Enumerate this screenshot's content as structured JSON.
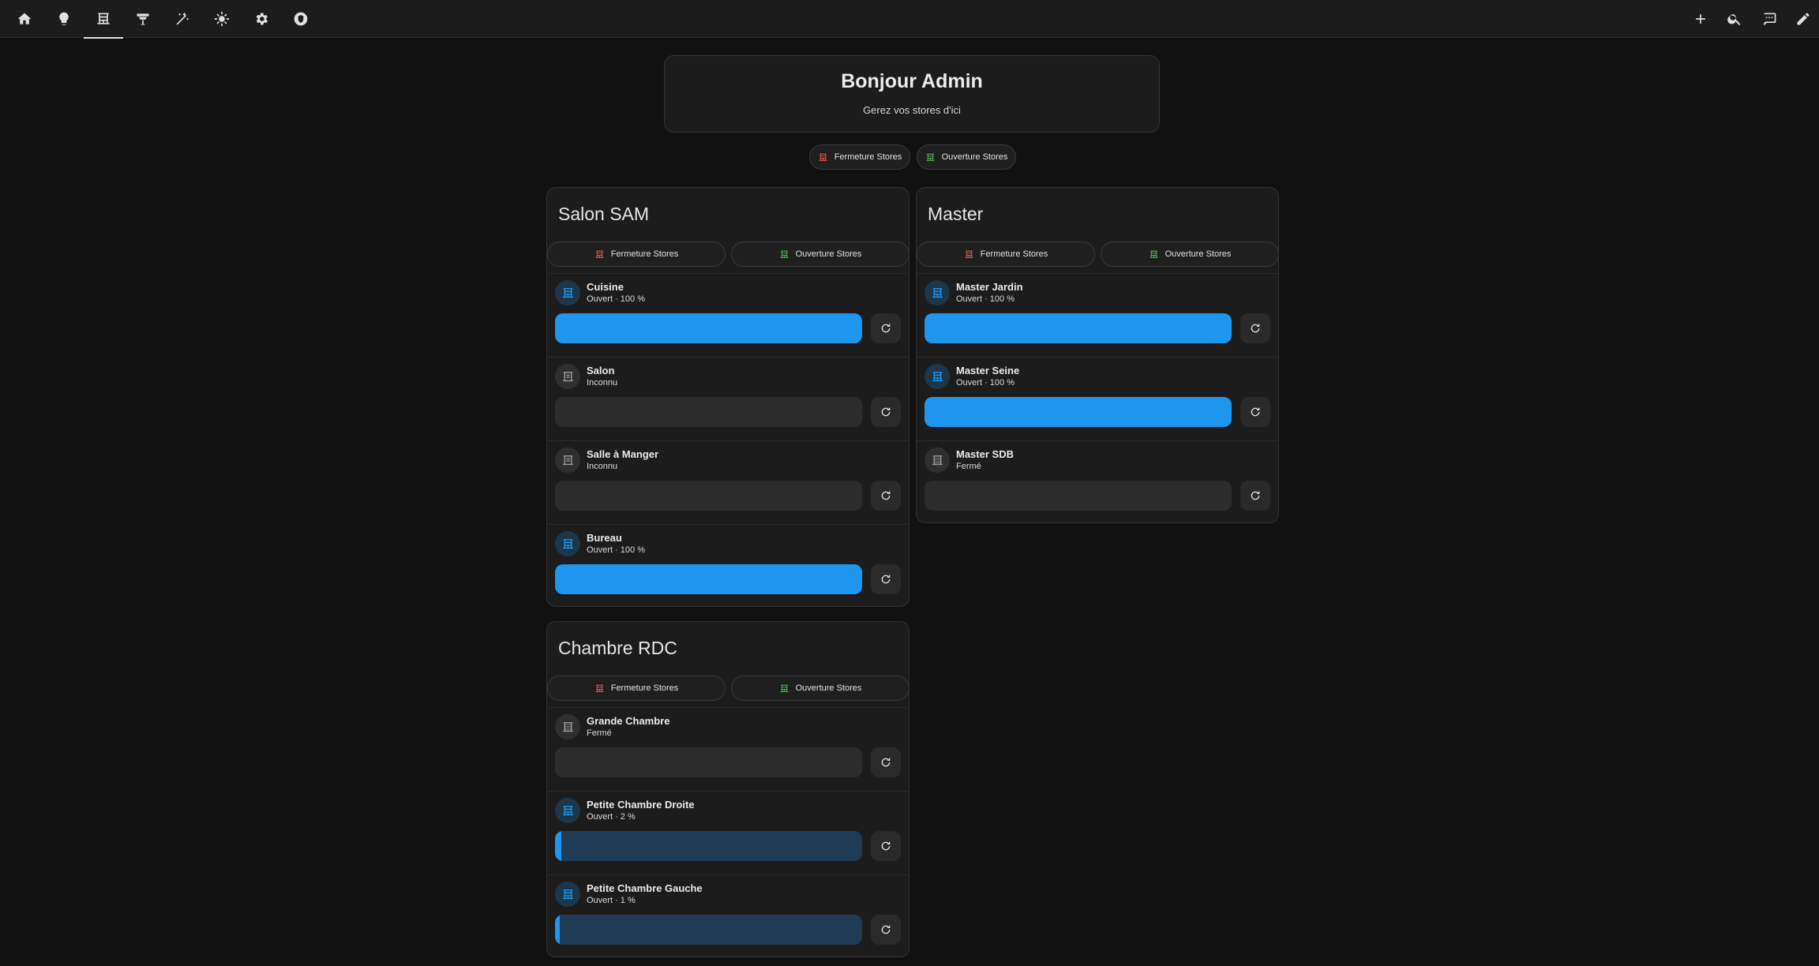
{
  "nav": {
    "tabs": [
      {
        "icon": "home-icon"
      },
      {
        "icon": "lightbulb-icon"
      },
      {
        "icon": "blinds-icon",
        "active": true
      },
      {
        "icon": "ceiling-light-icon"
      },
      {
        "icon": "magic-wand-icon"
      },
      {
        "icon": "sun-icon"
      },
      {
        "icon": "gear-icon"
      },
      {
        "icon": "shield-icon"
      }
    ],
    "actions": [
      {
        "icon": "plus-icon"
      },
      {
        "icon": "search-icon"
      },
      {
        "icon": "chat-icon"
      },
      {
        "icon": "pencil-icon"
      }
    ]
  },
  "welcome": {
    "title": "Bonjour Admin",
    "subtitle": "Gerez vos stores d'ici"
  },
  "global_actions": {
    "close_label": "Fermeture Stores",
    "open_label": "Ouverture Stores"
  },
  "colors": {
    "accent": "#1e96ee",
    "close_icon": "#e05252",
    "open_icon": "#4caf50"
  },
  "rooms": [
    {
      "title": "Salon SAM",
      "close_label": "Fermeture Stores",
      "open_label": "Ouverture Stores",
      "covers": [
        {
          "name": "Cuisine",
          "state": "Ouvert · 100 %",
          "position": 100,
          "known": true
        },
        {
          "name": "Salon",
          "state": "Inconnu",
          "position": 0,
          "known": false
        },
        {
          "name": "Salle à Manger",
          "state": "Inconnu",
          "position": 0,
          "known": false
        },
        {
          "name": "Bureau",
          "state": "Ouvert · 100 %",
          "position": 100,
          "known": true
        }
      ]
    },
    {
      "title": "Master",
      "close_label": "Fermeture Stores",
      "open_label": "Ouverture Stores",
      "covers": [
        {
          "name": "Master Jardin",
          "state": "Ouvert · 100 %",
          "position": 100,
          "known": true
        },
        {
          "name": "Master Seine",
          "state": "Ouvert · 100 %",
          "position": 100,
          "known": true
        },
        {
          "name": "Master SDB",
          "state": "Fermé",
          "position": 0,
          "known": true
        }
      ]
    },
    {
      "title": "Chambre RDC",
      "close_label": "Fermeture Stores",
      "open_label": "Ouverture Stores",
      "covers": [
        {
          "name": "Grande Chambre",
          "state": "Fermé",
          "position": 0,
          "known": true
        },
        {
          "name": "Petite Chambre Droite",
          "state": "Ouvert · 2 %",
          "position": 2,
          "known": true
        },
        {
          "name": "Petite Chambre Gauche",
          "state": "Ouvert · 1 %",
          "position": 1,
          "known": true
        }
      ]
    }
  ]
}
